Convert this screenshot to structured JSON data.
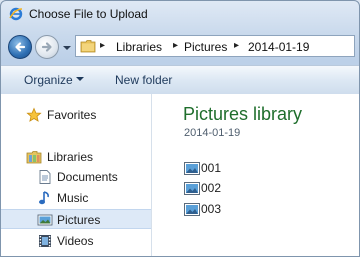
{
  "window": {
    "title": "Choose File to Upload"
  },
  "address_bar": {
    "breadcrumbs": [
      "Libraries",
      "Pictures",
      "2014-01-19"
    ]
  },
  "toolbar": {
    "organize_label": "Organize",
    "new_folder_label": "New folder"
  },
  "nav_pane": {
    "favorites_label": "Favorites",
    "libraries_label": "Libraries",
    "items": [
      "Documents",
      "Music",
      "Pictures",
      "Videos"
    ],
    "selected": "Pictures"
  },
  "content": {
    "title": "Pictures library",
    "subtitle": "2014-01-19",
    "files": [
      "001",
      "002",
      "003"
    ]
  },
  "colors": {
    "accent_title": "#1f6e2c",
    "selection": "#dde9f7"
  }
}
